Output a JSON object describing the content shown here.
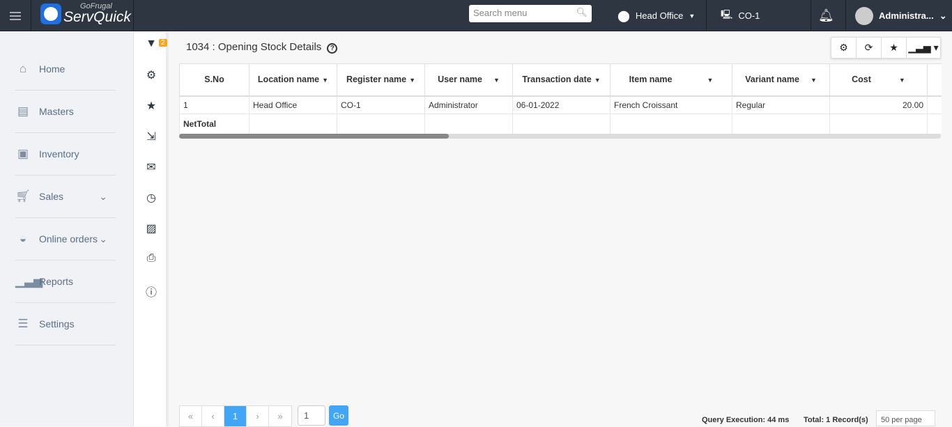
{
  "header": {
    "brand_top": "GoFrugal",
    "brand": "ServQuick",
    "search_placeholder": "Search menu",
    "location": "Head Office",
    "register": "CO-1",
    "user": "Administra..."
  },
  "sidebar": {
    "items": [
      {
        "label": "Home",
        "icon": "home-icon"
      },
      {
        "label": "Masters",
        "icon": "masters-icon"
      },
      {
        "label": "Inventory",
        "icon": "inventory-icon"
      },
      {
        "label": "Sales",
        "icon": "cart-icon",
        "expandable": true
      },
      {
        "label": "Online orders",
        "icon": "online-orders-icon",
        "expandable": true
      },
      {
        "label": "Reports",
        "icon": "reports-icon"
      },
      {
        "label": "Settings",
        "icon": "settings-icon"
      }
    ]
  },
  "tool_column": {
    "filter_badge": "2",
    "icons": [
      "filter-icon",
      "gear-icon",
      "star-icon",
      "export-icon",
      "mail-icon",
      "clock-icon",
      "schedule-icon",
      "print-icon",
      "help-icon"
    ]
  },
  "report": {
    "title": "1034 : Opening Stock Details",
    "columns": [
      "S.No",
      "Location name",
      "Register name",
      "User name",
      "Transaction date",
      "Item name",
      "Variant name",
      "Cost"
    ],
    "rows": [
      [
        "1",
        "Head Office",
        "CO-1",
        "Administrator",
        "06-01-2022",
        "French Croissant",
        "Regular",
        "20.00"
      ]
    ],
    "net_total_label": "NetTotal"
  },
  "pagination": {
    "first": "«",
    "prev": "‹",
    "current": "1",
    "next": "›",
    "last": "»",
    "page_input": "1",
    "go": "Go",
    "query_execution": "Query Execution: 44 ms",
    "total": "Total: 1 Record(s)",
    "per_page": "50 per page"
  }
}
